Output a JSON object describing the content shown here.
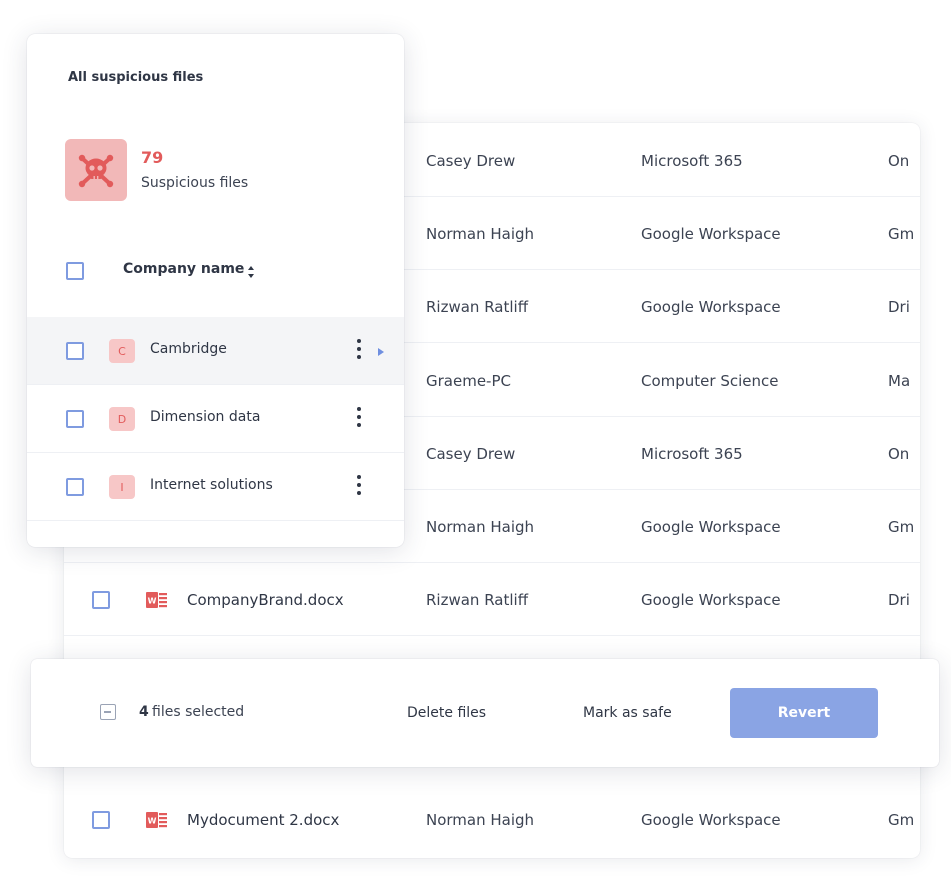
{
  "panel": {
    "title": "All suspicious files",
    "count": "79",
    "count_label": "Suspicious files",
    "column_header": "Company name",
    "companies": [
      {
        "letter": "C",
        "name": "Cambridge"
      },
      {
        "letter": "D",
        "name": "Dimension data"
      },
      {
        "letter": "I",
        "name": "Internet solutions"
      }
    ]
  },
  "table": {
    "rows": [
      {
        "file": "",
        "owner": "Casey Drew",
        "source": "Microsoft 365",
        "location": "On"
      },
      {
        "file": "",
        "owner": "Norman Haigh",
        "source": "Google Workspace",
        "location": "Gm"
      },
      {
        "file": "",
        "owner": "Rizwan Ratliff",
        "source": "Google Workspace",
        "location": "Dri"
      },
      {
        "file": "",
        "owner": "Graeme-PC",
        "source": "Computer Science",
        "location": "Ma"
      },
      {
        "file": "",
        "owner": "Casey Drew",
        "source": "Microsoft 365",
        "location": "On"
      },
      {
        "file": "",
        "owner": "Norman Haigh",
        "source": "Google Workspace",
        "location": "Gm"
      },
      {
        "file": "CompanyBrand.docx",
        "owner": "Rizwan Ratliff",
        "source": "Google Workspace",
        "location": "Dri"
      },
      {
        "file": "Mydocument 2.docx",
        "owner": "Norman Haigh",
        "source": "Google Workspace",
        "location": "Gm"
      }
    ]
  },
  "action_bar": {
    "selected_count": "4",
    "selected_text": "files selected",
    "delete_label": "Delete files",
    "mark_safe_label": "Mark as safe",
    "revert_label": "Revert"
  },
  "colors": {
    "accent": "#8aa4e4",
    "danger": "#e25b5b",
    "danger_bg": "#f2b8b8",
    "checkbox": "#7f9be0"
  },
  "icons": {
    "threat": "skull-crossbones-icon",
    "file": "word-document-icon",
    "sort": "sort-icon",
    "menu": "kebab-menu-icon"
  }
}
